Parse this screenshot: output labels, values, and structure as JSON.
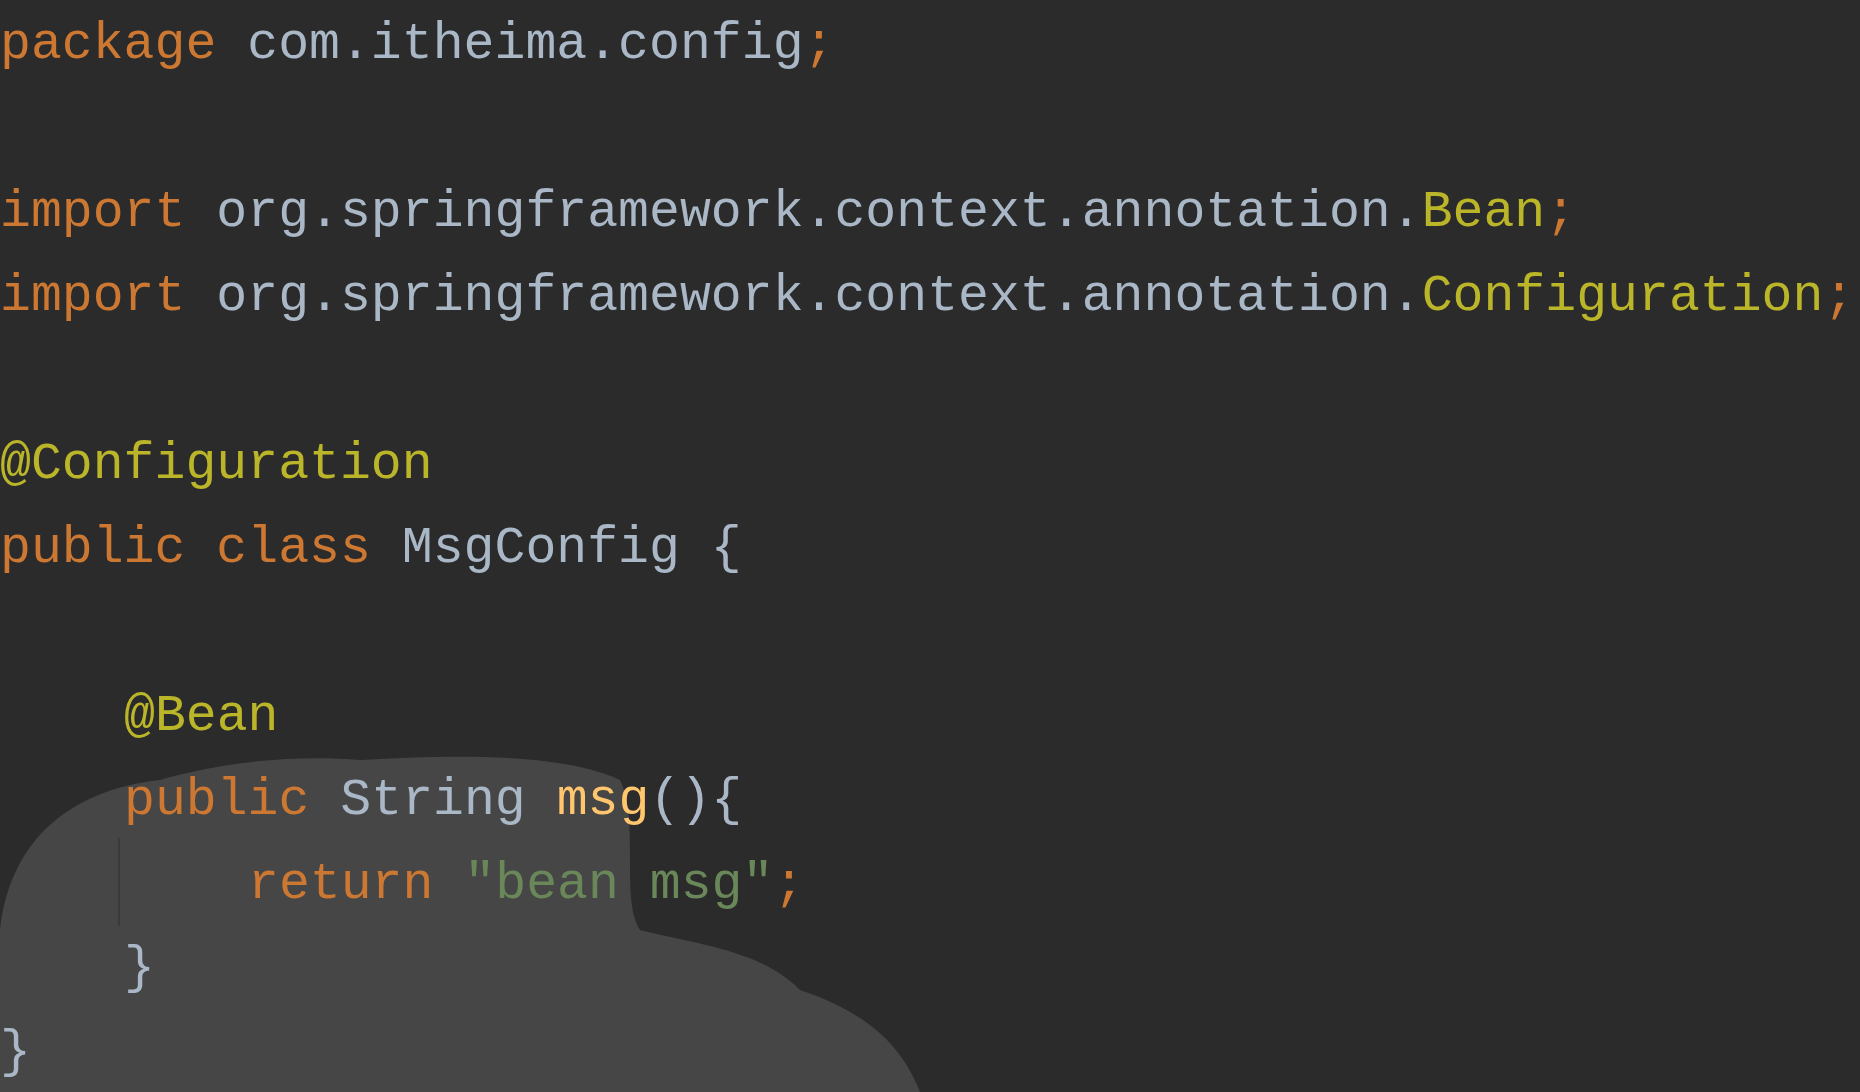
{
  "editor": {
    "lines": [
      {
        "kind": "code",
        "tokens": [
          {
            "kind": "keyword",
            "text": "package "
          },
          {
            "kind": "plain",
            "text": "com.itheima.config"
          },
          {
            "kind": "keyword",
            "text": ";"
          }
        ]
      },
      {
        "kind": "blank"
      },
      {
        "kind": "code",
        "tokens": [
          {
            "kind": "keyword",
            "text": "import "
          },
          {
            "kind": "plain",
            "text": "org.springframework.context.annotation."
          },
          {
            "kind": "annotation",
            "text": "Bean"
          },
          {
            "kind": "keyword",
            "text": ";"
          }
        ]
      },
      {
        "kind": "code",
        "tokens": [
          {
            "kind": "keyword",
            "text": "import "
          },
          {
            "kind": "plain",
            "text": "org.springframework.context.annotation."
          },
          {
            "kind": "annotation",
            "text": "Configuration"
          },
          {
            "kind": "keyword",
            "text": ";"
          }
        ]
      },
      {
        "kind": "blank"
      },
      {
        "kind": "code",
        "tokens": [
          {
            "kind": "annotation",
            "text": "@Configuration"
          }
        ]
      },
      {
        "kind": "code",
        "tokens": [
          {
            "kind": "keyword",
            "text": "public class "
          },
          {
            "kind": "plain",
            "text": "MsgConfig {"
          }
        ],
        "children": [
          {
            "kind": "blank"
          },
          {
            "kind": "code",
            "tokens": [
              {
                "kind": "annotation",
                "text": "@Bean"
              }
            ]
          },
          {
            "kind": "code",
            "tokens": [
              {
                "kind": "keyword",
                "text": "public "
              },
              {
                "kind": "plain",
                "text": "String "
              },
              {
                "kind": "method",
                "text": "msg"
              },
              {
                "kind": "plain",
                "text": "(){"
              }
            ],
            "children": [
              {
                "kind": "code",
                "tokens": [
                  {
                    "kind": "keyword",
                    "text": "return "
                  },
                  {
                    "kind": "string",
                    "text": "\"bean msg\""
                  },
                  {
                    "kind": "keyword",
                    "text": ";"
                  }
                ]
              }
            ]
          },
          {
            "kind": "code",
            "tokens": [
              {
                "kind": "plain",
                "text": "}"
              }
            ]
          }
        ]
      },
      {
        "kind": "code",
        "tokens": [
          {
            "kind": "plain",
            "text": "}"
          }
        ]
      }
    ]
  }
}
